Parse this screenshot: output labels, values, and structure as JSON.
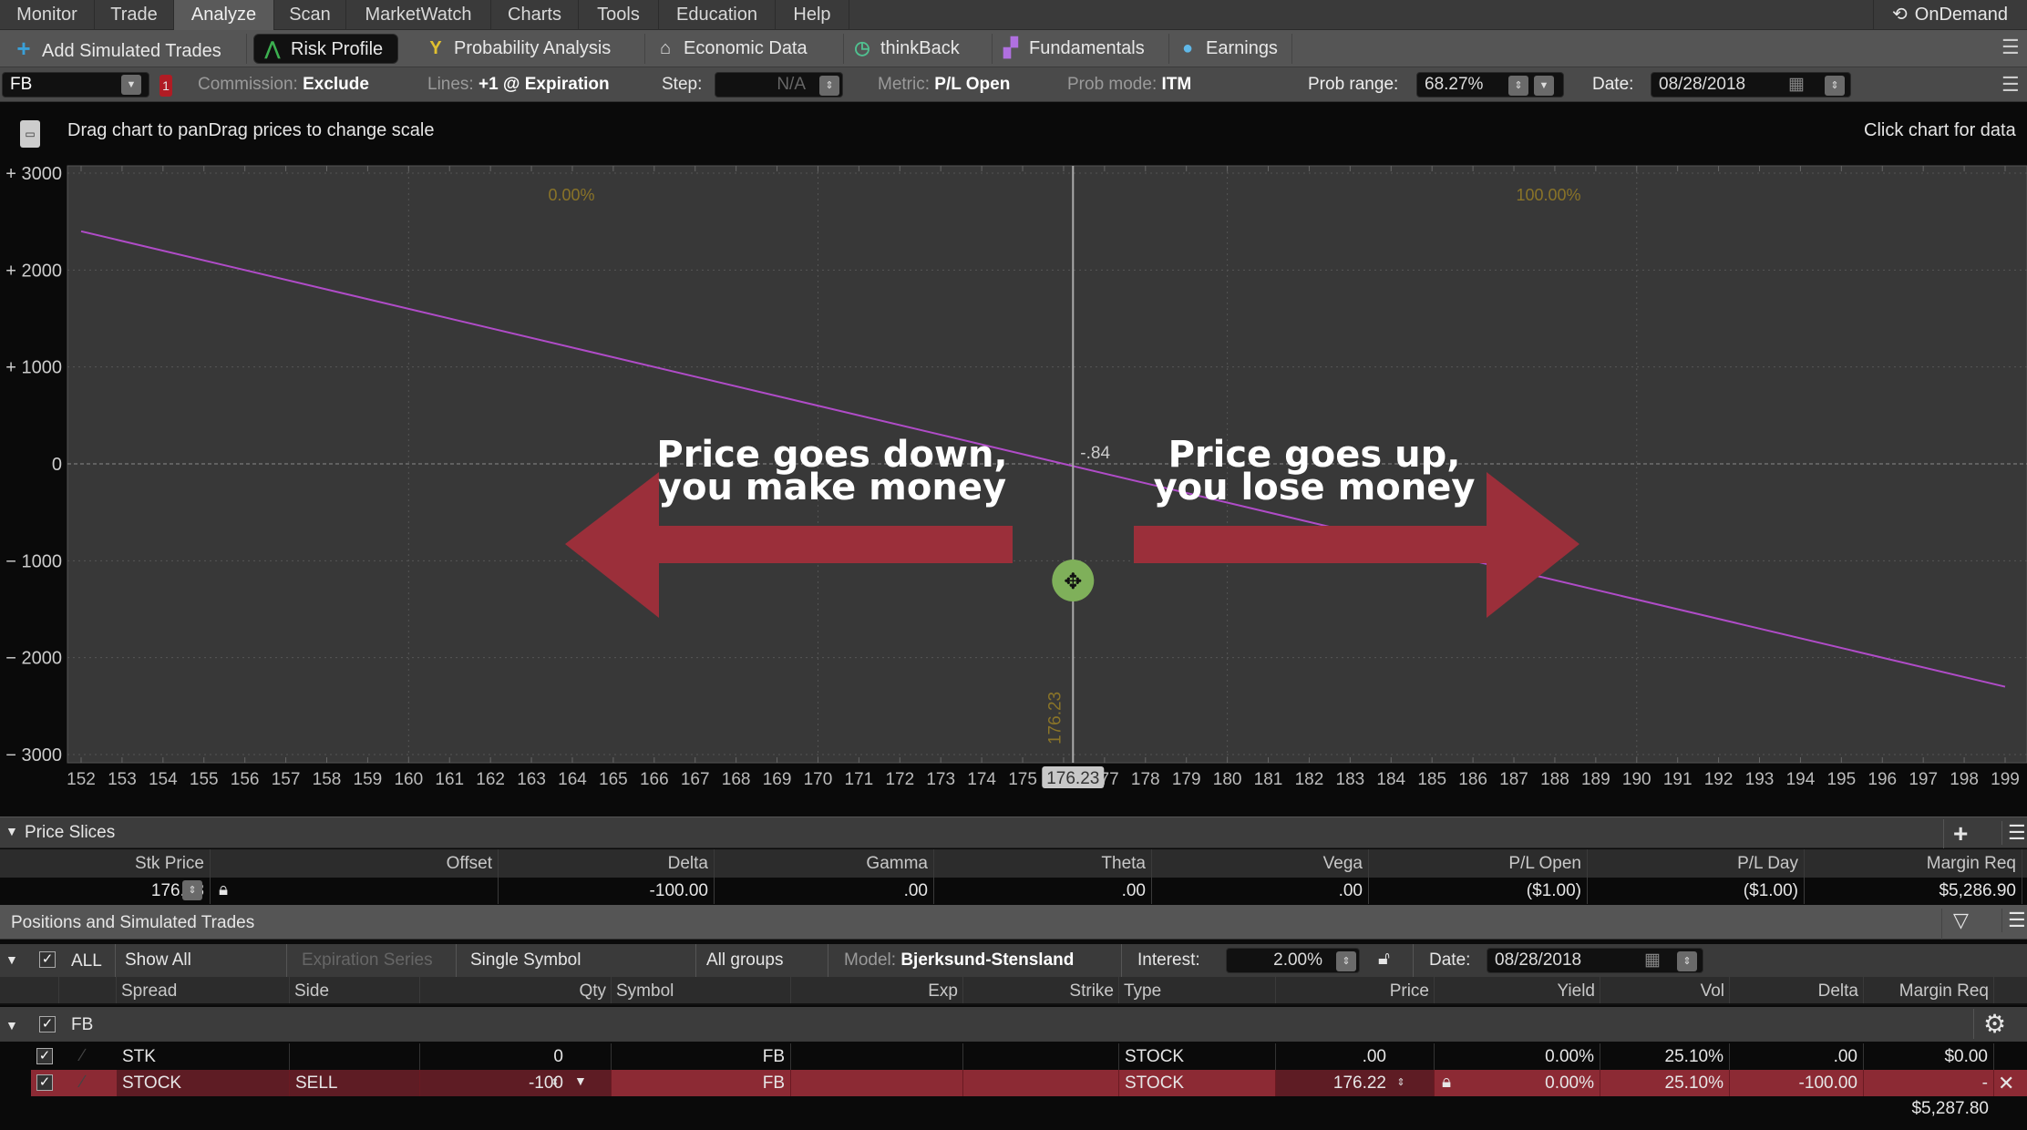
{
  "menu": {
    "items": [
      "Monitor",
      "Trade",
      "Analyze",
      "Scan",
      "MarketWatch",
      "Charts",
      "Tools",
      "Education",
      "Help"
    ],
    "active": "Analyze",
    "ondemand": "OnDemand"
  },
  "toolbar": {
    "items": [
      "Add Simulated Trades",
      "Risk Profile",
      "Probability Analysis",
      "Economic Data",
      "thinkBack",
      "Fundamentals",
      "Earnings"
    ],
    "selected": "Risk Profile"
  },
  "settings": {
    "symbol": "FB",
    "badge": "1",
    "commission_label": "Commission:",
    "commission_value": "Exclude",
    "lines_label": "Lines:",
    "lines_value": "+1 @ Expiration",
    "step_label": "Step:",
    "step_value": "N/A",
    "metric_label": "Metric:",
    "metric_value": "P/L Open",
    "prob_mode_label": "Prob mode:",
    "prob_mode_value": "ITM",
    "prob_range_label": "Prob range:",
    "prob_range_value": "68.27%",
    "date_label": "Date:",
    "date_value": "08/28/2018"
  },
  "info": {
    "left_hint": "Drag chart to panDrag prices to change scale",
    "right_hint": "Click chart for data"
  },
  "chart_data": {
    "type": "line",
    "xlim": [
      152,
      199
    ],
    "ylim": [
      -3000,
      3000
    ],
    "xticks": [
      152,
      153,
      154,
      155,
      156,
      157,
      158,
      159,
      160,
      161,
      162,
      163,
      164,
      165,
      166,
      167,
      168,
      169,
      170,
      171,
      172,
      173,
      174,
      175,
      176,
      177,
      178,
      179,
      180,
      181,
      182,
      183,
      184,
      185,
      186,
      187,
      188,
      189,
      190,
      191,
      192,
      193,
      194,
      195,
      196,
      197,
      198,
      199
    ],
    "yticks": [
      {
        "v": 3000,
        "label": "+ 3000"
      },
      {
        "v": 2000,
        "label": "+ 2000"
      },
      {
        "v": 1000,
        "label": "+ 1000"
      },
      {
        "v": 0,
        "label": "0"
      },
      {
        "v": -1000,
        "label": "− 1000"
      },
      {
        "v": -2000,
        "label": "− 2000"
      },
      {
        "v": -3000,
        "label": "− 3000"
      }
    ],
    "grid": true,
    "series": [
      {
        "x": [
          152,
          199
        ],
        "y": [
          2400,
          -2300
        ],
        "color": "#b04cc8"
      }
    ],
    "current_price": 176.23,
    "current_price_label": "176.23",
    "pl_at_price": "-.84",
    "prob_left": "0.00%",
    "prob_right": "100.00%"
  },
  "annotations": {
    "left": [
      "Price goes down,",
      "you make money"
    ],
    "right": [
      "Price goes up,",
      "you lose money"
    ],
    "arrow_color": "#9b2f3a"
  },
  "price_slices": {
    "title": "Price Slices",
    "columns": [
      "Stk Price",
      "Offset",
      "Delta",
      "Gamma",
      "Theta",
      "Vega",
      "P/L Open",
      "P/L Day",
      "Margin Req"
    ],
    "row": {
      "stk_price": "176.23",
      "offset": "",
      "delta": "-100.00",
      "gamma": ".00",
      "theta": ".00",
      "vega": ".00",
      "pl_open": "($1.00)",
      "pl_day": "($1.00)",
      "margin_req": "$5,286.90"
    }
  },
  "positions": {
    "title": "Positions and Simulated Trades",
    "filters": {
      "all": "ALL",
      "show": "Show All",
      "expiration": "Expiration Series",
      "symbol_mode": "Single Symbol",
      "groups": "All groups",
      "model_label": "Model:",
      "model_value": "Bjerksund-Stensland",
      "interest_label": "Interest:",
      "interest_value": "2.00%",
      "date_label": "Date:",
      "date_value": "08/28/2018"
    },
    "columns": [
      "Spread",
      "Side",
      "Qty",
      "Symbol",
      "Exp",
      "Strike",
      "Type",
      "Price",
      "Yield",
      "Vol",
      "Delta",
      "Margin Req"
    ],
    "group": "FB",
    "rows": [
      {
        "spread": "STK",
        "side": "",
        "qty": "0",
        "symbol": "FB",
        "exp": "",
        "strike": "",
        "type": "STOCK",
        "price": ".00",
        "yield": "0.00%",
        "vol": "25.10%",
        "delta": ".00",
        "margin": "$0.00"
      },
      {
        "spread": "STOCK",
        "side": "SELL",
        "qty": "-100",
        "symbol": "FB",
        "exp": "",
        "strike": "",
        "type": "STOCK",
        "price": "176.22",
        "yield": "0.00%",
        "vol": "25.10%",
        "delta": "-100.00",
        "margin": "-"
      }
    ],
    "total_margin": "$5,287.80"
  }
}
